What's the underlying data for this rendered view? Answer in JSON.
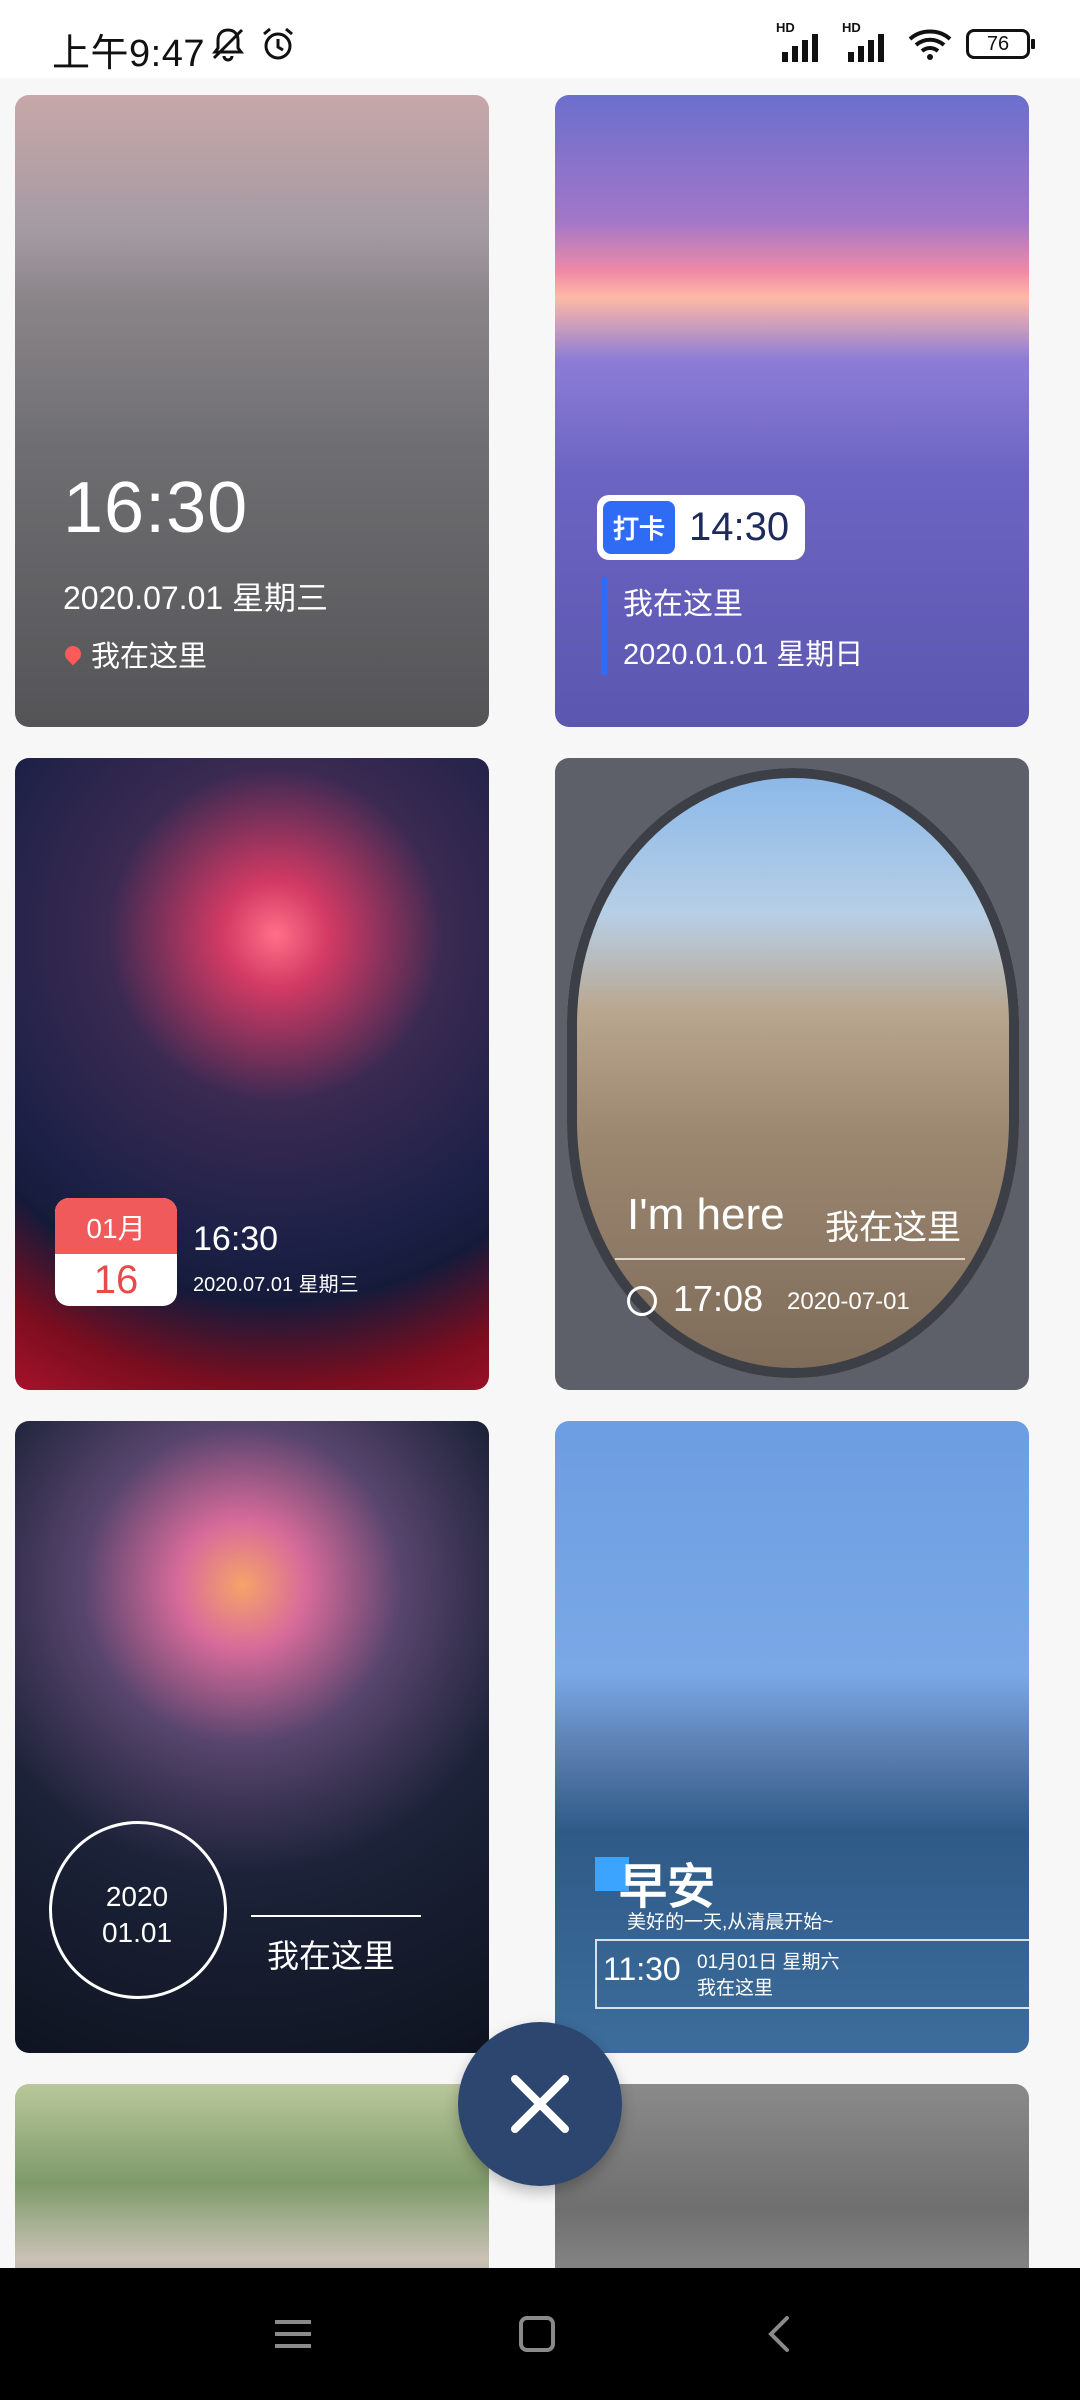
{
  "status_bar": {
    "time": "上午9:47",
    "signal1": "HD",
    "signal2": "HD",
    "battery": "76"
  },
  "cards": {
    "c1": {
      "time": "16:30",
      "date": "2020.07.01 星期三",
      "location": "我在这里"
    },
    "c2": {
      "tag": "打卡",
      "time": "14:30",
      "line1": "我在这里",
      "line2": "2020.01.01   星期日"
    },
    "c3": {
      "month": "01月",
      "day": "16",
      "time": "16:30",
      "date": "2020.07.01 星期三"
    },
    "c4": {
      "here": "I'm here",
      "here_cn": "我在这里",
      "time": "17:08",
      "date": "2020-07-01"
    },
    "c5": {
      "year": "2020",
      "md": "01.01",
      "text": "我在这里"
    },
    "c6": {
      "title": "早安",
      "subtitle": "美好的一天,从清晨开始~",
      "time": "11:30",
      "date": "01月01日 星期六",
      "location": "我在这里"
    }
  },
  "colors": {
    "fab": "#2d4670",
    "accent_blue": "#2f6cf6",
    "calendar_red": "#f05a5a"
  },
  "icons": [
    "bell-off-icon",
    "alarm-icon",
    "wifi-icon",
    "pin-icon",
    "clock-icon",
    "close-icon",
    "menu-icon",
    "home-icon",
    "back-icon"
  ]
}
